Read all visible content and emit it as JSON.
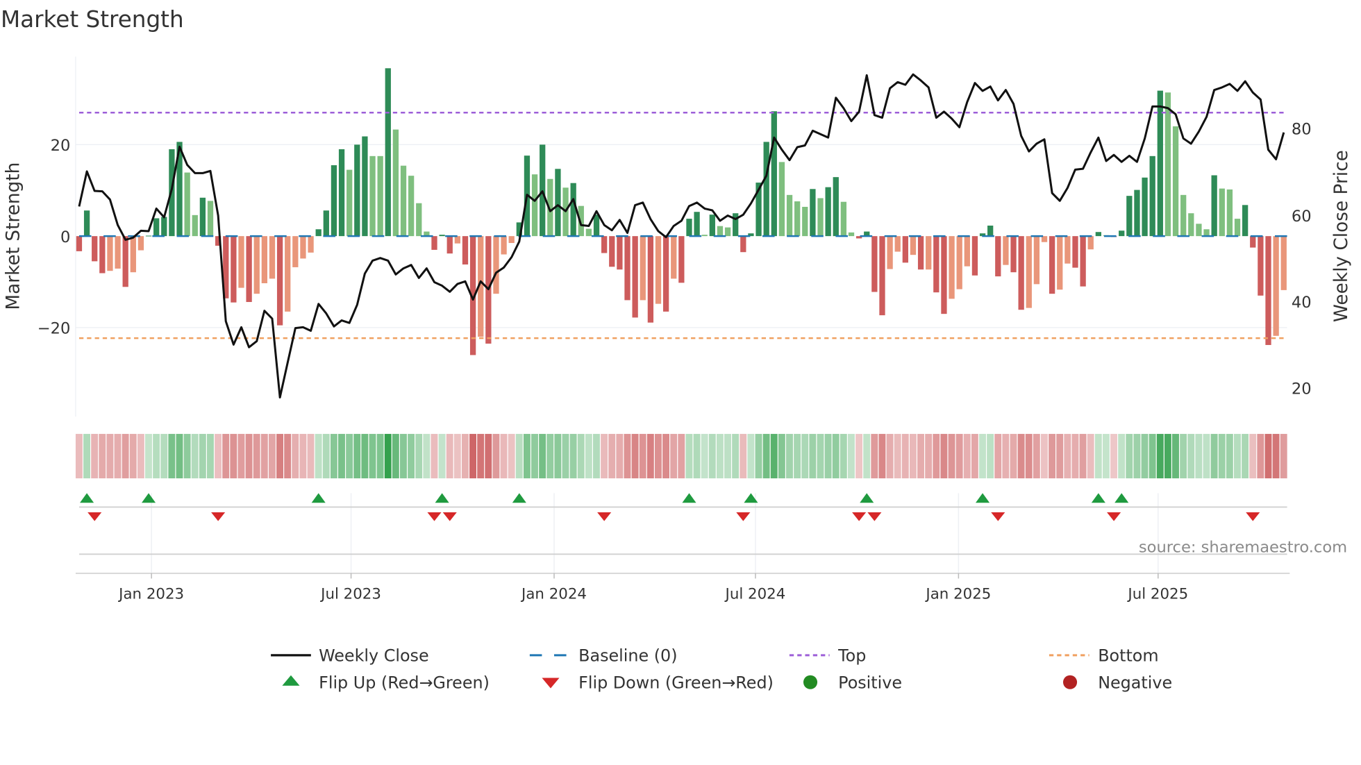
{
  "title": "Market Strength",
  "source": "source: sharemaestro.com",
  "legend": {
    "weekly_close": "Weekly Close",
    "baseline": "Baseline (0)",
    "top": "Top",
    "bottom": "Bottom",
    "flip_up": "Flip Up (Red→Green)",
    "flip_down": "Flip Down (Green→Red)",
    "positive": "Positive",
    "negative": "Negative"
  },
  "colors": {
    "strong_up": "#2e8b57",
    "weak_up": "#7fbf7f",
    "strong_down": "#cd5c5c",
    "weak_down": "#e9967a",
    "price": "#111111",
    "baseline": "#1f77b4",
    "top": "#9d5fd8",
    "bottom": "#f0a060",
    "flip_up": "#1f9a3f",
    "flip_down": "#d62728",
    "positive": "#228b22",
    "negative": "#b22222"
  },
  "chart_data": {
    "type": "bar",
    "title": "Market Strength",
    "ylabel": "Market Strength",
    "y2label": "Weekly Close Price",
    "frequency": "weekly",
    "x_range": [
      "2022-10-30",
      "2025-10-19"
    ],
    "ylim": [
      -36,
      39
    ],
    "y2lim": [
      14,
      90
    ],
    "yticks": [
      "20",
      "0",
      "−20"
    ],
    "y2ticks": [
      "80",
      "60",
      "40",
      "20"
    ],
    "xticks": [
      "Jan 2023",
      "Jul 2023",
      "Jan 2024",
      "Jul 2024",
      "Jan 2025",
      "Jul 2025"
    ],
    "top_level": 27,
    "bottom_level": -22.3,
    "baseline": 0,
    "strength": [
      -3.3,
      5.6,
      -5.5,
      -8.1,
      -7.6,
      -7.1,
      -11.1,
      -7.9,
      -3.1,
      0.1,
      3.9,
      4.2,
      19,
      20.6,
      13.9,
      4.6,
      8.4,
      7.7,
      -2.1,
      -13.6,
      -14.5,
      -11.3,
      -14.4,
      -12.6,
      -10.3,
      -9.3,
      -19.5,
      -16.5,
      -6.8,
      -4.9,
      -3.6,
      1.5,
      5.6,
      15.5,
      19,
      14.5,
      20,
      21.8,
      17.5,
      17.5,
      36.7,
      23.3,
      15.4,
      13.2,
      7.2,
      1,
      -3,
      0.3,
      -3.8,
      -1.6,
      -6.2,
      -26,
      -22,
      -23.5,
      -12.6,
      -4,
      -1.5,
      3,
      17.6,
      13.5,
      20,
      12.5,
      14.7,
      10.6,
      11.6,
      6.6,
      1.6,
      4.7,
      -3.7,
      -6.7,
      -7.3,
      -14,
      -17.8,
      -14,
      -18.9,
      -14.8,
      -16.5,
      -9.3,
      -10.2,
      3.8,
      5.3,
      0.3,
      4.7,
      2.2,
      1.9,
      5,
      -3.5,
      0.6,
      11.7,
      20.6,
      27.3,
      16.2,
      9,
      7.6,
      6.4,
      10.3,
      8.3,
      10.7,
      12.9,
      7.5,
      0.8,
      -0.5,
      1,
      -12.2,
      -17.3,
      -7.2,
      -3.4,
      -5.8,
      -4.1,
      -7.3,
      -7.3,
      -12.3,
      -17,
      -13.7,
      -11.6,
      -6.6,
      -8.6,
      0.6,
      2.3,
      -8.8,
      -6.3,
      -7.9,
      -16.1,
      -15.7,
      -10.5,
      -1.3,
      -12.6,
      -11.7,
      -6,
      -6.9,
      -11,
      -2.9,
      0.9,
      0.2,
      -0.2,
      1.2,
      8.8,
      10.1,
      12.8,
      17.5,
      31.8,
      31.4,
      24,
      9,
      5,
      2.7,
      1.5,
      13.3,
      10.4,
      10.2,
      3.8,
      6.8,
      -2.5,
      -13,
      -23.8,
      -21.8,
      -11.8
    ],
    "weekly_close": [
      61.9,
      70.0,
      65.5,
      65.4,
      63.5,
      57.6,
      54.2,
      54.7,
      56.3,
      56.2,
      61.4,
      59.4,
      65.9,
      75.7,
      71.5,
      69.6,
      69.6,
      70.1,
      59.8,
      35.4,
      30,
      34,
      29.4,
      30.8,
      37.8,
      36,
      17.8,
      25.8,
      33.8,
      34,
      33.2,
      39.4,
      37.2,
      34.2,
      35.6,
      35,
      39.2,
      46.4,
      49.4,
      50,
      49.4,
      46.2,
      47.6,
      48.4,
      45.4,
      47.6,
      44.4,
      43.6,
      42.2,
      44,
      44.6,
      40.4,
      44.6,
      42.8,
      46.6,
      47.8,
      50.2,
      53.8,
      64.6,
      63.2,
      65.4,
      60.8,
      62.2,
      60.8,
      63.6,
      57.6,
      57.4,
      60.8,
      57.6,
      56.4,
      58.8,
      55.8,
      62.2,
      62.8,
      59,
      56.2,
      54.8,
      57.4,
      58.6,
      62,
      62.8,
      61.4,
      61,
      58.6,
      59.8,
      59,
      60,
      62.6,
      65.8,
      69,
      77.8,
      75,
      72.6,
      75.6,
      76,
      79.4,
      78.6,
      77.8,
      87,
      84.6,
      81.6,
      83.8,
      92.2,
      83,
      82.4,
      89.2,
      90.6,
      90,
      92.4,
      91,
      89.4,
      82.4,
      83.8,
      82.2,
      80.2,
      86,
      90.4,
      88.6,
      89.6,
      86.4,
      88.8,
      85.6,
      78.2,
      74.6,
      76.4,
      77.4,
      65,
      63.2,
      66.2,
      70.4,
      70.6,
      74.4,
      77.8,
      72.4,
      73.8,
      72.2,
      73.6,
      72.2,
      77.6,
      85,
      85,
      84.6,
      83.2,
      77.6,
      76.4,
      79.2,
      82.6,
      88.8,
      89.4,
      90.2,
      88.6,
      90.8,
      88.2,
      86.6,
      75,
      72.8,
      79
    ],
    "legend_position": "bottom",
    "grid": true
  }
}
